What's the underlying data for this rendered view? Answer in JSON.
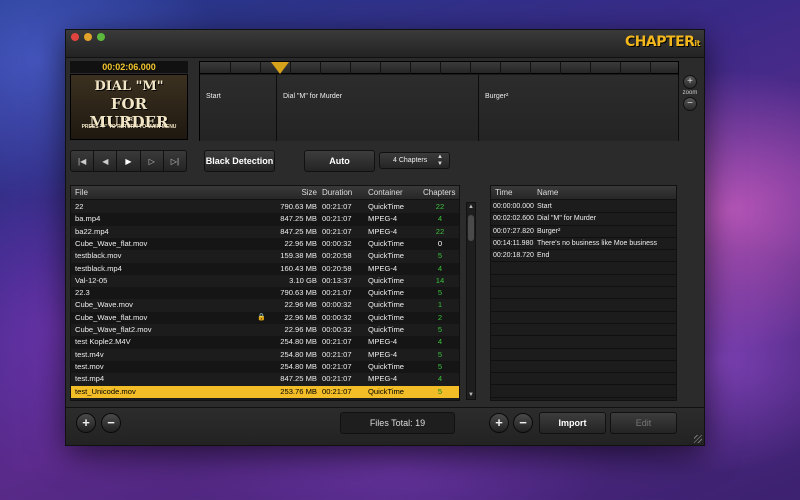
{
  "app": {
    "logo_main": "CHAPTER",
    "logo_sub": "it"
  },
  "preview": {
    "timecode": "00:02:06.000",
    "line1": "DIAL \"M\"",
    "line2": "FOR MURDER",
    "line3": "OR\nPRESS \"#\" TO RETURN TO MAIN MENU"
  },
  "timeline": {
    "segments": [
      "Start",
      "Dial \"M\" for Murder",
      "Burger²"
    ],
    "zoom_label": "zoom",
    "zoom_in": "+",
    "zoom_out": "−"
  },
  "toolbar": {
    "black_detection": "Black Detection",
    "auto": "Auto",
    "chapters_select": "4 Chapters"
  },
  "files": {
    "columns": [
      "File",
      "Size",
      "Duration",
      "Container",
      "Chapters"
    ],
    "rows": [
      [
        "22",
        "790.63 MB",
        "00:21:07",
        "QuickTime",
        "22"
      ],
      [
        "ba.mp4",
        "847.25 MB",
        "00:21:07",
        "MPEG-4",
        "4"
      ],
      [
        "ba22.mp4",
        "847.25 MB",
        "00:21:07",
        "MPEG-4",
        "22"
      ],
      [
        "Cube_Wave_flat.mov",
        "22.96 MB",
        "00:00:32",
        "QuickTime",
        "0"
      ],
      [
        "testblack.mov",
        "159.38 MB",
        "00:20:58",
        "QuickTime",
        "5"
      ],
      [
        "testblack.mp4",
        "160.43 MB",
        "00:20:58",
        "MPEG-4",
        "4"
      ],
      [
        "Val-12-05",
        "3.10 GB",
        "00:13:37",
        "QuickTime",
        "14"
      ],
      [
        "22.3",
        "790.63 MB",
        "00:21:07",
        "QuickTime",
        "5"
      ],
      [
        "Cube_Wave.mov",
        "22.96 MB",
        "00:00:32",
        "QuickTime",
        "1"
      ],
      [
        "Cube_Wave_flat.mov",
        "22.96 MB",
        "00:00:32",
        "QuickTime",
        "2"
      ],
      [
        "Cube_Wave_flat2.mov",
        "22.96 MB",
        "00:00:32",
        "QuickTime",
        "5"
      ],
      [
        "test Kople2.M4V",
        "254.80 MB",
        "00:21:07",
        "MPEG-4",
        "4"
      ],
      [
        "test.m4v",
        "254.80 MB",
        "00:21:07",
        "MPEG-4",
        "5"
      ],
      [
        "test.mov",
        "254.80 MB",
        "00:21:07",
        "QuickTime",
        "5"
      ],
      [
        "test.mp4",
        "847.25 MB",
        "00:21:07",
        "MPEG-4",
        "4"
      ],
      [
        "test_Unicode.mov",
        "253.76 MB",
        "00:21:07",
        "QuickTime",
        "5"
      ]
    ],
    "selected_index": 15,
    "locked_index": 9,
    "total_label": "Files Total: 19"
  },
  "chapters": {
    "columns": [
      "Time",
      "Name"
    ],
    "rows": [
      [
        "00:00:00.000",
        "Start"
      ],
      [
        "00:02:02.600",
        "Dial \"M\" for Murder"
      ],
      [
        "00:07:27.820",
        "Burger²"
      ],
      [
        "00:14:11.980",
        "There's no business like Moe business"
      ],
      [
        "00:20:18.720",
        "End"
      ]
    ]
  },
  "bottom": {
    "add": "+",
    "remove": "−",
    "import": "Import",
    "edit": "Edit"
  },
  "colors": {
    "accent": "#f2bd26",
    "chapters_count": "#38c23a"
  }
}
